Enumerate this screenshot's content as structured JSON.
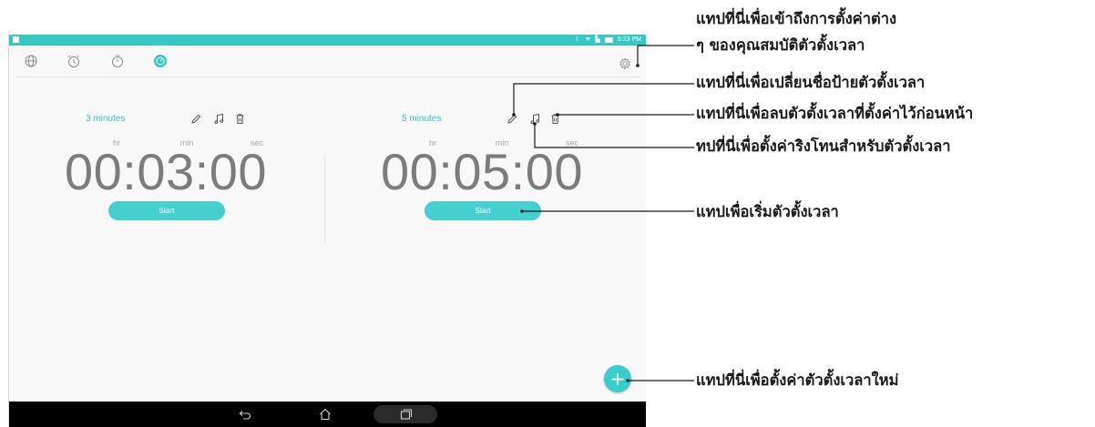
{
  "status_bar": {
    "time": "5:23 PM",
    "icons": [
      "notification-icon",
      "moon-icon",
      "wifi-icon",
      "data-icon",
      "battery-icon"
    ]
  },
  "tabs": [
    {
      "name": "world-clock",
      "icon": "globe-icon"
    },
    {
      "name": "alarm",
      "icon": "alarm-clock-icon"
    },
    {
      "name": "stopwatch",
      "icon": "stopwatch-icon"
    },
    {
      "name": "timer",
      "icon": "timer-icon",
      "selected": true
    }
  ],
  "settings_icon": "gear-icon",
  "units": {
    "hr": "hr",
    "min": "min",
    "sec": "sec"
  },
  "timers": [
    {
      "name": "3 minutes",
      "clock": "00:03:00",
      "start_label": "Start"
    },
    {
      "name": "5 minutes",
      "clock": "00:05:00",
      "start_label": "Start"
    }
  ],
  "card_icons": [
    "pencil-icon",
    "music-note-icon",
    "trash-icon"
  ],
  "fab": {
    "label": "+",
    "icon": "plus-icon"
  },
  "nav": {
    "icons": [
      "back-icon",
      "home-icon",
      "recents-icon"
    ]
  },
  "annotations": {
    "settings": [
      "แทปที่นี่เพื่อเข้าถึงการตั้งค่าต่าง",
      "ๆ ของคุณสมบัติตัวตั้งเวลา"
    ],
    "rename": "แทปที่นี่เพื่อเปลี่ยนชื่อป้ายตัวตั้งเวลา",
    "delete": "แทปที่นี่เพื่อลบตัวตั้งเวลาที่ตั้งค่าไว้ก่อนหน้า",
    "ringtone": "ทปที่นี่เพื่อตั้งค่าริงโทนสำหรับตัวตั้งเวลา",
    "start": "แทปเพื่อเริ่มตัวตั้งเวลา",
    "new": "แทปที่นี่เพื่อตั้งค่าตัวตั้งเวลาใหม่"
  },
  "colors": {
    "accent": "#36c7c7",
    "start_button": "#45cfd0",
    "clock_text": "#7c7c7c",
    "nav_bar": "#000000"
  }
}
